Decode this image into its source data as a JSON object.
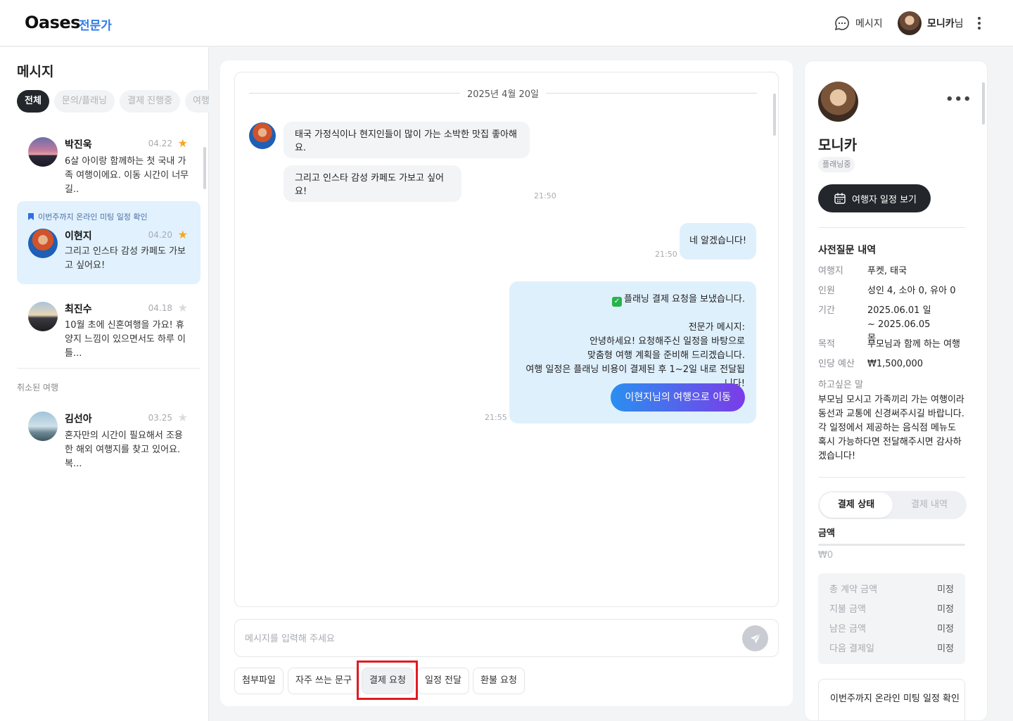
{
  "header": {
    "logo": "Oases",
    "logo_sub": "전문가",
    "messages_label": "메시지",
    "user_name": "모니카",
    "user_suffix": "님"
  },
  "sidebar": {
    "title": "메시지",
    "filters": [
      {
        "label": "전체",
        "active": true
      },
      {
        "label": "문의/플래닝",
        "active": false
      },
      {
        "label": "결제 진행중",
        "active": false
      },
      {
        "label": "여행중",
        "active": false
      }
    ],
    "conversations": [
      {
        "name": "박진욱",
        "date": "04.22",
        "starred": true,
        "pinned_note": "",
        "preview": "6살 아이랑 함께하는 첫 국내 가족 여행이에요. 이동 시간이 너무 길..",
        "selected": false
      },
      {
        "name": "이현지",
        "date": "04.20",
        "starred": true,
        "pinned_note": "이번주까지 온라인 미팅 일정 확인",
        "preview": "그리고 인스타 감성 카페도 가보고 싶어요!",
        "selected": true
      },
      {
        "name": "최진수",
        "date": "04.18",
        "starred": false,
        "pinned_note": "",
        "preview": "10월 초에 신혼여행을 가요! 휴양지 느낌이 있으면서도 하루 이틀...",
        "selected": false
      }
    ],
    "cancelled_title": "취소된 여행",
    "cancelled": [
      {
        "name": "김선아",
        "date": "03.25",
        "starred": false,
        "preview": "혼자만의 시간이 필요해서 조용한 해외 여행지를 찾고 있어요. 복..."
      }
    ]
  },
  "chat": {
    "date_divider": "2025년 4월 20일",
    "incoming": [
      {
        "text": "태국 가정식이나 현지인들이 많이 가는 소박한 맛집 좋아해요."
      },
      {
        "text": "그리고 인스타 감성 카페도 가보고 싶어요!"
      }
    ],
    "incoming_time": "21:50",
    "outgoing_short": {
      "text": "네 알겠습니다!",
      "time": "21:50"
    },
    "outgoing_payment": {
      "check": "✓",
      "title": "플래닝 결제 요청을 보냈습니다.",
      "expert_label": "전문가 메시지:",
      "line1": "안녕하세요! 요청해주신 일정을 바탕으로",
      "line2": "맞춤형 여행 계획을 준비해 드리겠습니다.",
      "line3": "여행 일정은 플래닝 비용이 결제된 후 1~2일 내로 전달됩니다!",
      "button": "이현지님의 여행으로 이동",
      "time": "21:55"
    },
    "input_placeholder": "메시지를 입력해 주세요",
    "quick_buttons": [
      "첨부파일",
      "자주 쓰는 문구",
      "결제 요청",
      "일정 전달",
      "환불 요청"
    ]
  },
  "profile": {
    "name": "모니카",
    "status": "플래닝중",
    "schedule_button": "여행자 일정 보기",
    "section_title": "사전질문 내역",
    "fields": [
      {
        "k": "여행지",
        "v": "푸켓, 태국"
      },
      {
        "k": "인원",
        "v": "성인 4, 소아 0, 유아 0"
      },
      {
        "k": "기간",
        "v": "2025.06.01 일 ~ 2025.06.05 목"
      },
      {
        "k": "목적",
        "v": "부모님과 함께 하는 여행"
      },
      {
        "k": "인당 예산",
        "v": "₩1,500,000"
      }
    ],
    "wish_label": "하고싶은 말",
    "wish_text": "부모님 모시고 가족끼리 가는 여행이라 동선과 교통에 신경써주시길 바랍니다. 각 일정에서 제공하는 음식점 메뉴도 혹시 가능하다면 전달해주시면 감사하겠습니다!",
    "tabs": [
      "결제 상태",
      "결제 내역"
    ],
    "amount_label": "금액",
    "amount_value": "₩0",
    "amount_progress": 0,
    "payments": [
      {
        "k": "총 계약 금액",
        "v": "미정"
      },
      {
        "k": "지불 금액",
        "v": "미정"
      },
      {
        "k": "남은 금액",
        "v": "미정"
      },
      {
        "k": "다음 결제일",
        "v": "미정"
      }
    ],
    "note": "이번주까지 온라인 미팅 일정 확인"
  },
  "colors": {
    "accent_blue": "#2f7be5",
    "selected_bg": "#e1f1fd",
    "star": "#f5a623",
    "highlight_outline": "#e11b22"
  }
}
